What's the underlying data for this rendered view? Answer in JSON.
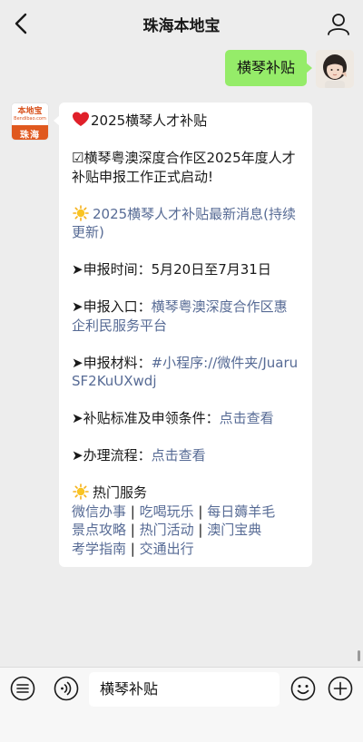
{
  "header": {
    "title": "珠海本地宝"
  },
  "outgoing": {
    "text": "横琴补贴"
  },
  "incoming": {
    "avatar": {
      "logo_cn": "本地宝",
      "logo_en": "Bendibao.com",
      "city": "珠海"
    },
    "title": "2025横琴人才补贴",
    "announce": "☑横琴粤澳深度合作区2025年度人才补贴申报工作正式启动!",
    "latest_link": "2025横琴人才补贴最新消息(持续更新)",
    "time_label": "➤申报时间：",
    "time_value": "5月20日至7月31日",
    "entry_label": "➤申报入口：",
    "entry_link": "横琴粤澳深度合作区惠企利民服务平台",
    "materials_label": "➤申报材料：",
    "materials_link": "#小程序://微件夹/JuaruSF2KuUXwdj",
    "standard_label": "➤补贴标准及申领条件：",
    "standard_link": "点击查看",
    "process_label": "➤办理流程：",
    "process_link": "点击查看",
    "hot_title": "热门服务",
    "hot_links": [
      "微信办事",
      "吃喝玩乐",
      "每日薅羊毛",
      "景点攻略",
      "热门活动",
      "澳门宝典",
      "考学指南",
      "交通出行"
    ],
    "separator": " | "
  },
  "input": {
    "value": "横琴补贴"
  },
  "colors": {
    "bubble_out": "#95ec69",
    "link": "#576b95",
    "background": "#ededed"
  }
}
